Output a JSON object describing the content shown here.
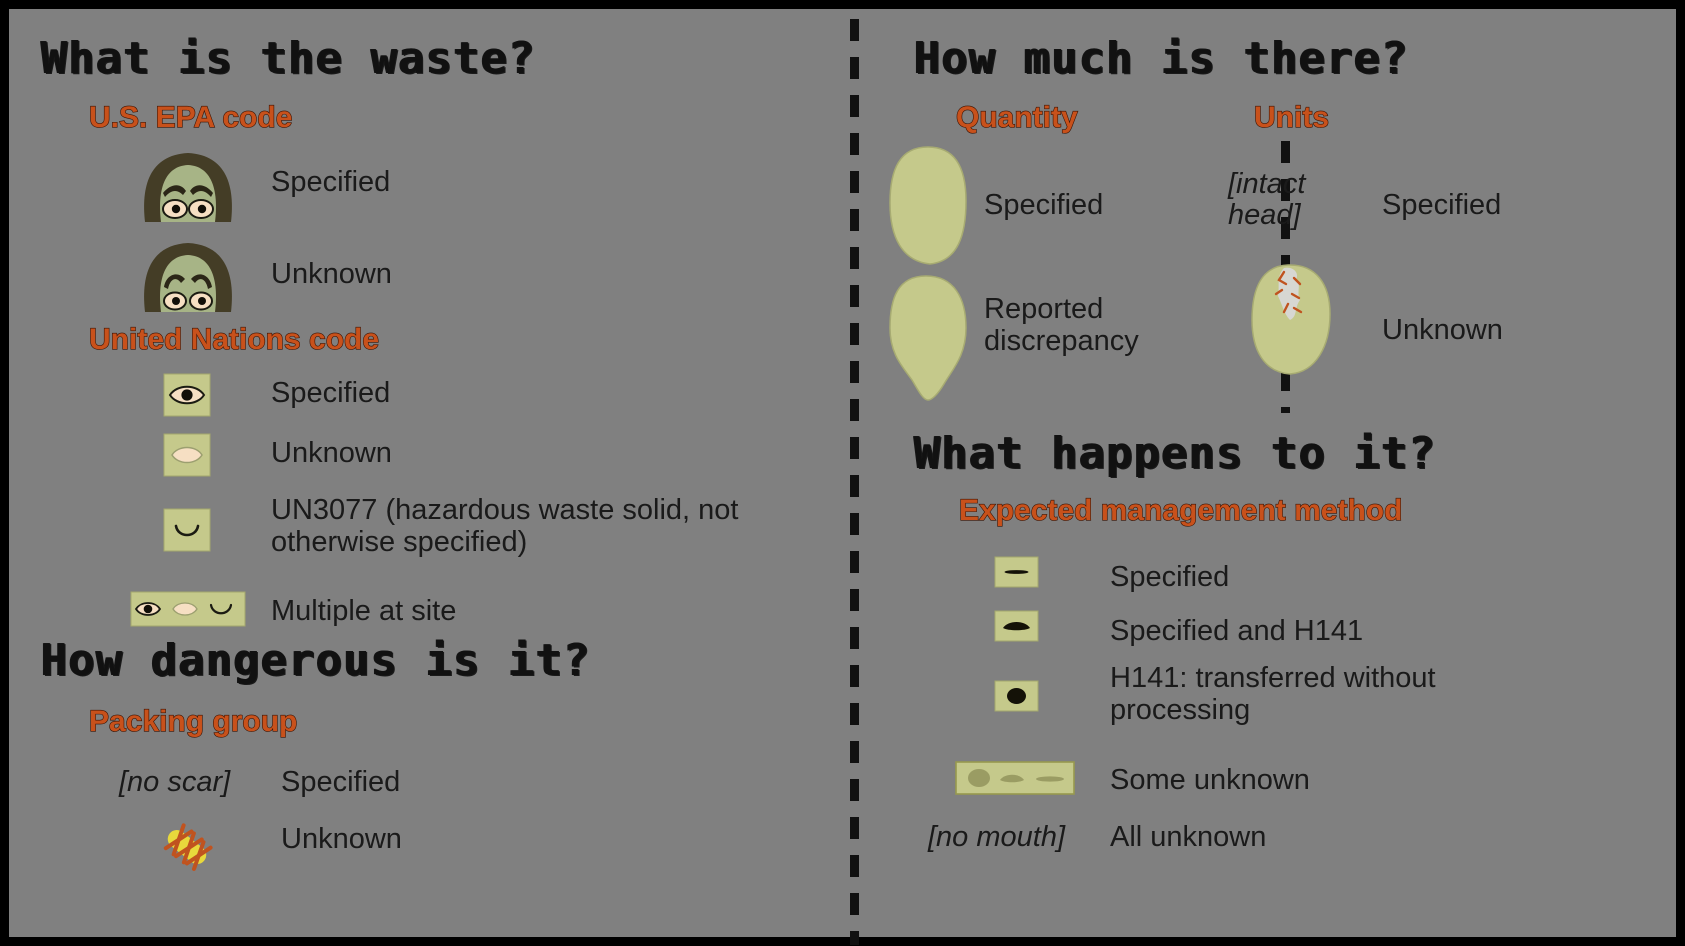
{
  "figure": {
    "background_color": "#808080",
    "border_color": "#000000",
    "accent_color": "#C8511B",
    "icon_fill": "#C5C98B",
    "skin_color": "#A7B486",
    "hair_color": "#443D26",
    "eye_white": "#F6DFC3",
    "scar_yellow": "#E8D83C",
    "scar_stitch": "#C0531F",
    "wound_gray": "#D7D7D2",
    "text_color": "#1a1a1a"
  },
  "left": {
    "question": "What is the waste?",
    "groups": [
      {
        "title": "U.S. EPA code",
        "items": [
          {
            "label": "Specified",
            "icon": "zombie-head-worried-brows"
          },
          {
            "label": "Unknown",
            "icon": "zombie-head-raised-brows"
          }
        ]
      },
      {
        "title": "United Nations code",
        "items": [
          {
            "label": "Specified",
            "icon": "eye-open-with-pupil-tile"
          },
          {
            "label": "Unknown",
            "icon": "eye-blank-no-pupil-tile"
          },
          {
            "label": "UN3077 (hazardous waste solid, not otherwise specified)",
            "icon": "eye-closed-smile-tile"
          },
          {
            "label": "Multiple at site",
            "icon": "three-eyes-tile"
          }
        ]
      }
    ],
    "question2": "How dangerous is it?",
    "groups2": [
      {
        "title": "Packing group",
        "items": [
          {
            "label": "Specified",
            "icon": "no-scar-text",
            "icon_text": "[no scar]"
          },
          {
            "label": "Unknown",
            "icon": "stitched-scar"
          }
        ]
      }
    ]
  },
  "right": {
    "question": "How much is there?",
    "groups": [
      {
        "title": "Quantity",
        "items": [
          {
            "label": "Specified",
            "icon": "head-blob-rounded"
          },
          {
            "label": "Reported discrepancy",
            "icon": "head-blob-dripping"
          }
        ]
      },
      {
        "title": "Units",
        "items": [
          {
            "label": "Specified",
            "icon": "intact-head-text",
            "icon_text": "[intact head]"
          },
          {
            "label": "Unknown",
            "icon": "head-blob-with-wound"
          }
        ]
      }
    ],
    "question2": "What happens to it?",
    "groups2": [
      {
        "title": "Expected management method",
        "items": [
          {
            "label": "Specified",
            "icon": "mouth-thin-line-tile"
          },
          {
            "label": "Specified and H141",
            "icon": "mouth-slightly-open-tile"
          },
          {
            "label": "H141: transferred without processing",
            "icon": "mouth-round-open-tile"
          },
          {
            "label": "Some unknown",
            "icon": "three-faded-mouths-tile"
          },
          {
            "label": "All unknown",
            "icon": "no-mouth-text",
            "icon_text": "[no mouth]"
          }
        ]
      }
    ]
  }
}
